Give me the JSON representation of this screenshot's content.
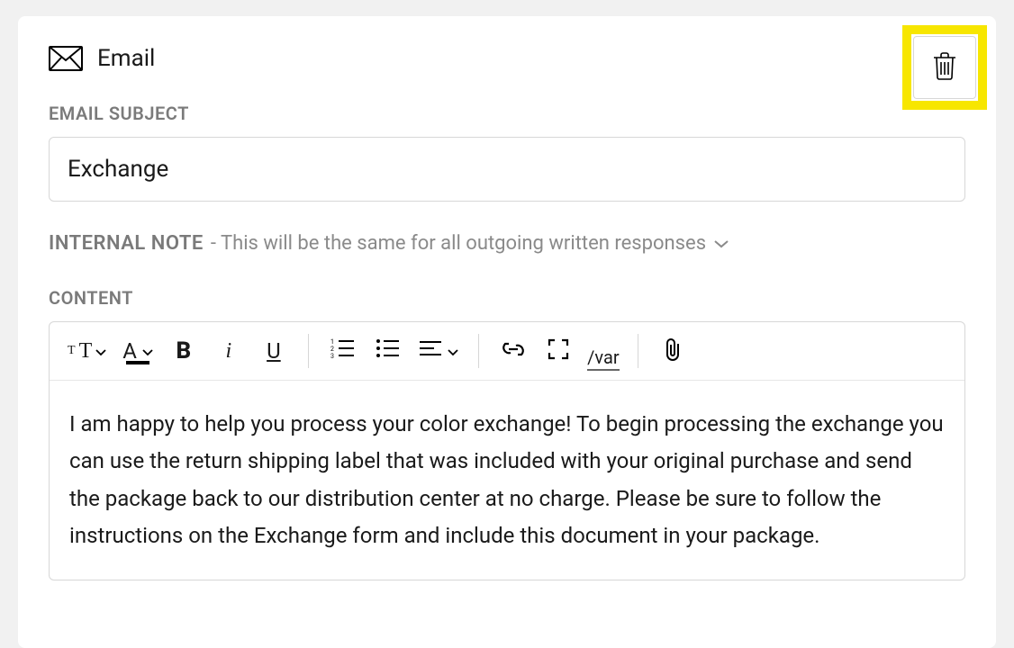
{
  "header": {
    "title": "Email"
  },
  "labels": {
    "subject": "EMAIL SUBJECT",
    "internal_note": "INTERNAL NOTE",
    "internal_note_desc": "- This will be the same for all outgoing written responses",
    "content": "CONTENT"
  },
  "subject_value": "Exchange",
  "editor": {
    "body_text": "I am happy to help you process your color exchange! To begin processing the exchange you can use the return shipping label that was included with your original purchase and send the package back to our distribution center at no charge. Please be sure to follow the instructions on the Exchange form and include this document in your package."
  },
  "toolbar": {
    "var_label": "/var"
  },
  "colors": {
    "highlight": "#f7e600",
    "border": "#d7d7d7",
    "muted": "#7a7a7a"
  }
}
